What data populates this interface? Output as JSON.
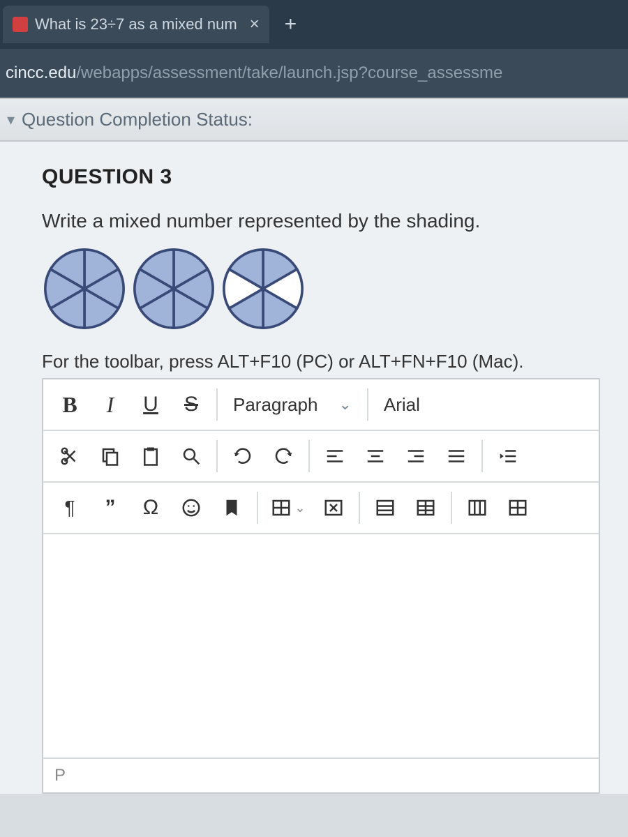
{
  "browser": {
    "tab_title": "What is 23÷7 as a mixed num",
    "tab_close": "×",
    "new_tab": "+",
    "url_host": "cincc.edu",
    "url_path": "/webapps/assessment/take/launch.jsp?course_assessme"
  },
  "status": {
    "label": "Question Completion Status:"
  },
  "question": {
    "heading": "QUESTION 3",
    "prompt": "Write a mixed number represented by the shading.",
    "circles": [
      {
        "slices": 6,
        "shaded": [
          0,
          1,
          2,
          3,
          4,
          5
        ]
      },
      {
        "slices": 6,
        "shaded": [
          0,
          1,
          2,
          3,
          4,
          5
        ]
      },
      {
        "slices": 6,
        "shaded": [
          0,
          2,
          3,
          5
        ]
      }
    ]
  },
  "editor": {
    "hint": "For the toolbar, press ALT+F10 (PC) or ALT+FN+F10 (Mac).",
    "row1": {
      "bold": "B",
      "italic": "I",
      "underline": "U",
      "strike": "S",
      "block_format": "Paragraph",
      "font_family": "Arial"
    },
    "statusbar": "P"
  }
}
